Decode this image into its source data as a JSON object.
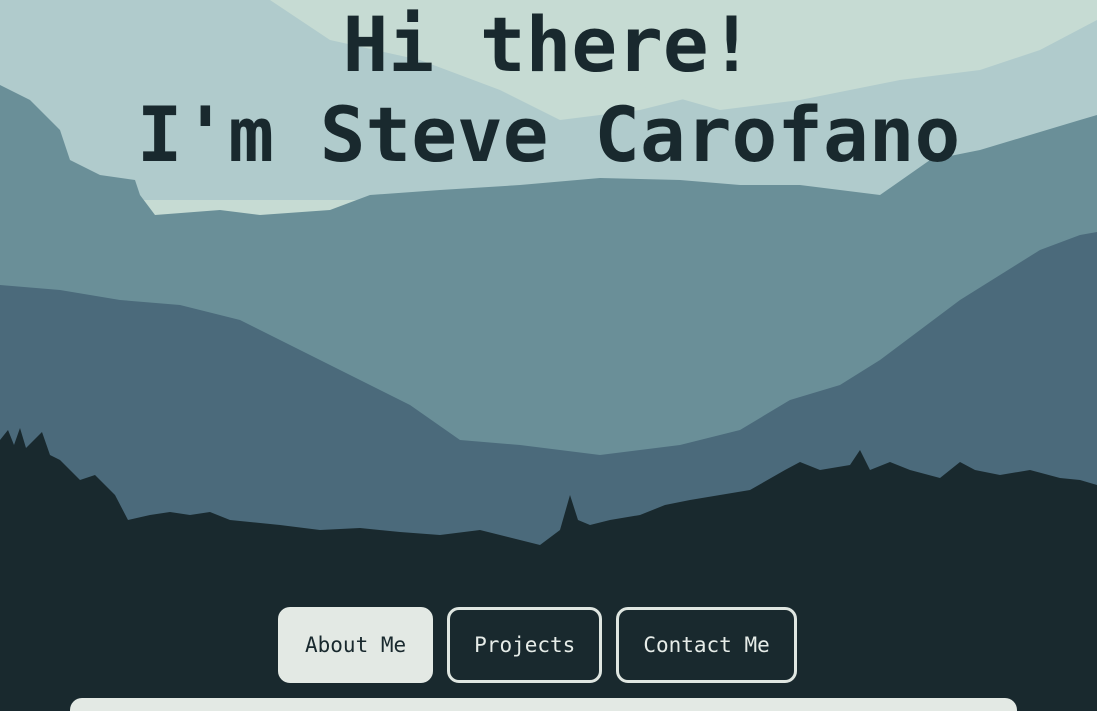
{
  "hero": {
    "line1": "Hi there!",
    "line2": "I'm Steve Carofano"
  },
  "nav": {
    "about_label": "About Me",
    "projects_label": "Projects",
    "contact_label": "Contact Me",
    "active": "About Me"
  },
  "colors": {
    "sky": "#c6dbd3",
    "far_hills": "#b0cbcc",
    "mid_hills": "#6a8f98",
    "near_hills": "#4b6a7b",
    "forest": "#19292e",
    "accent_light": "#e3e9e4"
  },
  "scene": {
    "background": "mountain-landscape-illustration"
  }
}
